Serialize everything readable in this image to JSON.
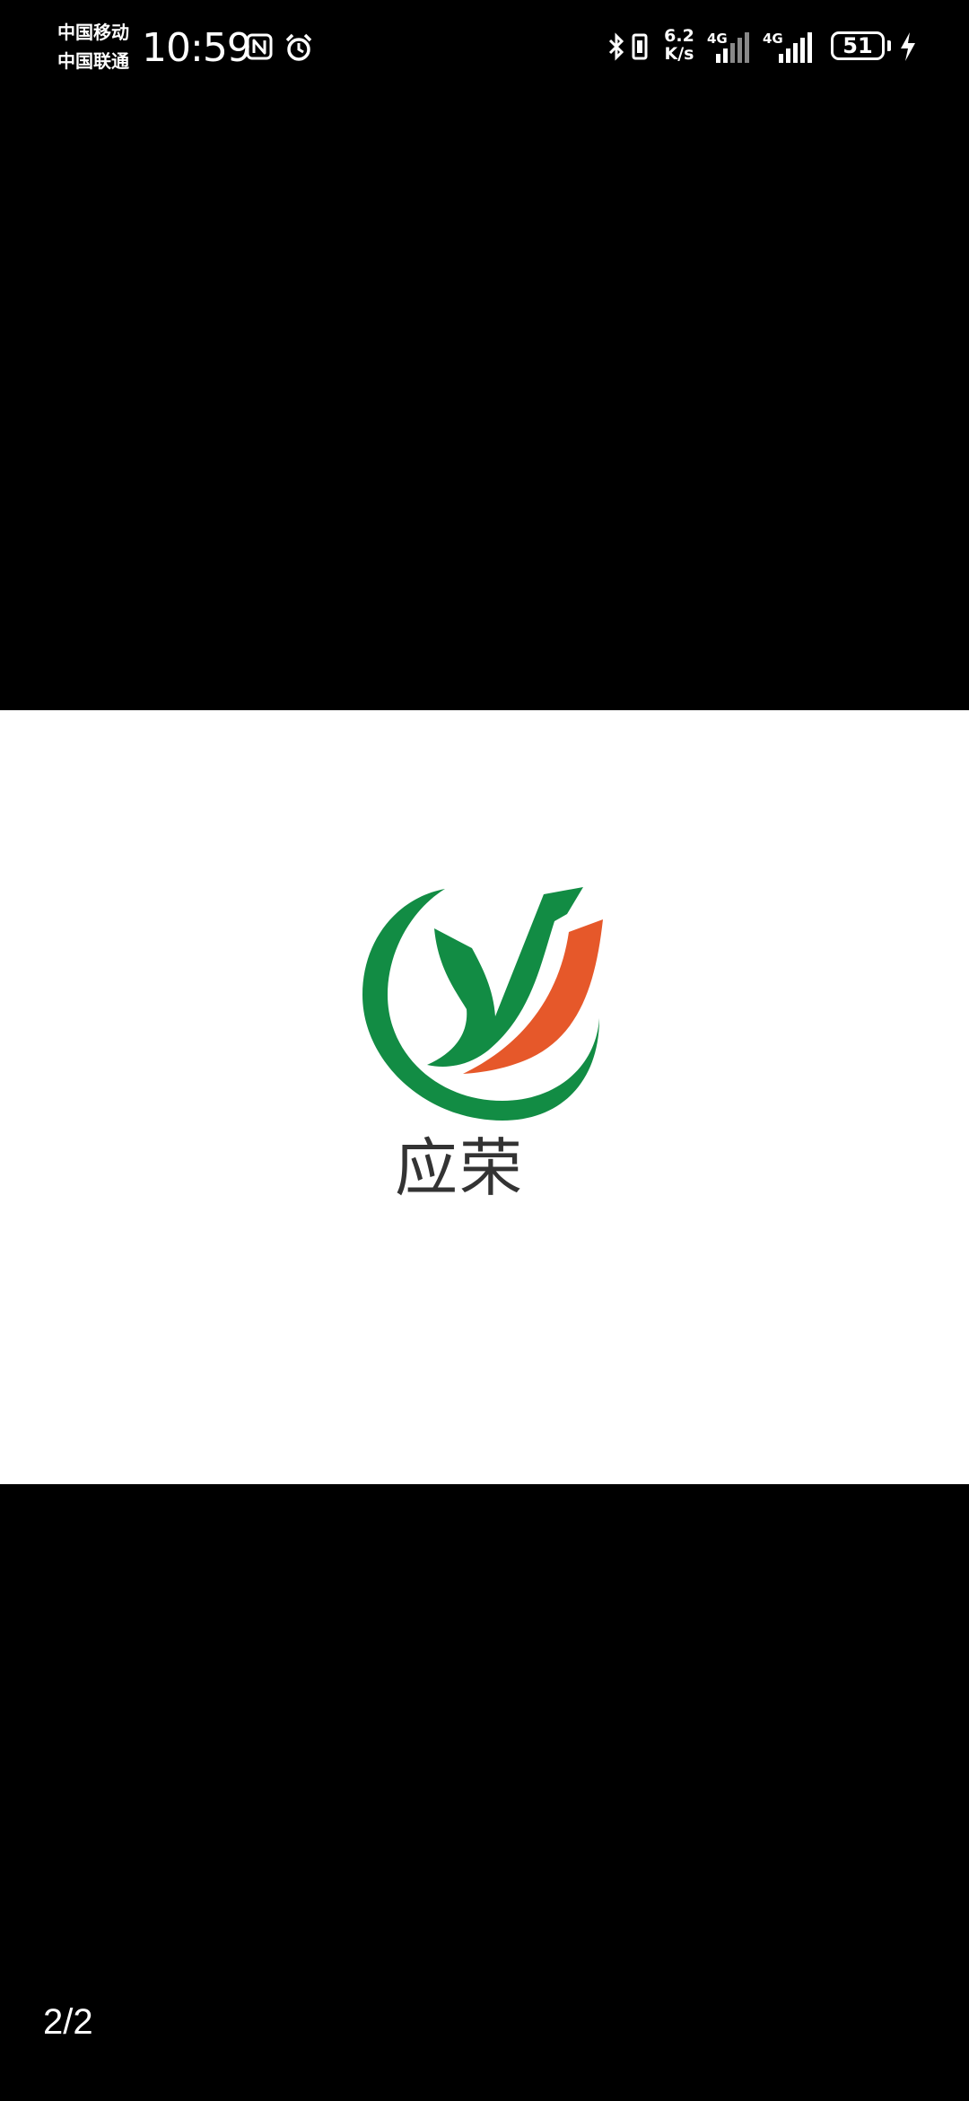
{
  "status_bar": {
    "carrier_1": "中国移动",
    "carrier_2": "中国联通",
    "time": "10:59",
    "net_speed_value": "6.2",
    "net_speed_unit": "K/s",
    "sim1_network": "4G",
    "sim2_network": "4G",
    "battery_level": "51",
    "icons": [
      "nfc-icon",
      "alarm-icon",
      "bluetooth-icon",
      "vibrate-icon",
      "signal-icon",
      "battery-icon",
      "charging-icon"
    ]
  },
  "viewer": {
    "logo_text": "应荣",
    "page_indicator": "2/2",
    "colors": {
      "background": "#000000",
      "image_background": "#ffffff",
      "logo_green": "#128c44",
      "logo_orange": "#e6582a",
      "logo_text": "#333333"
    }
  }
}
